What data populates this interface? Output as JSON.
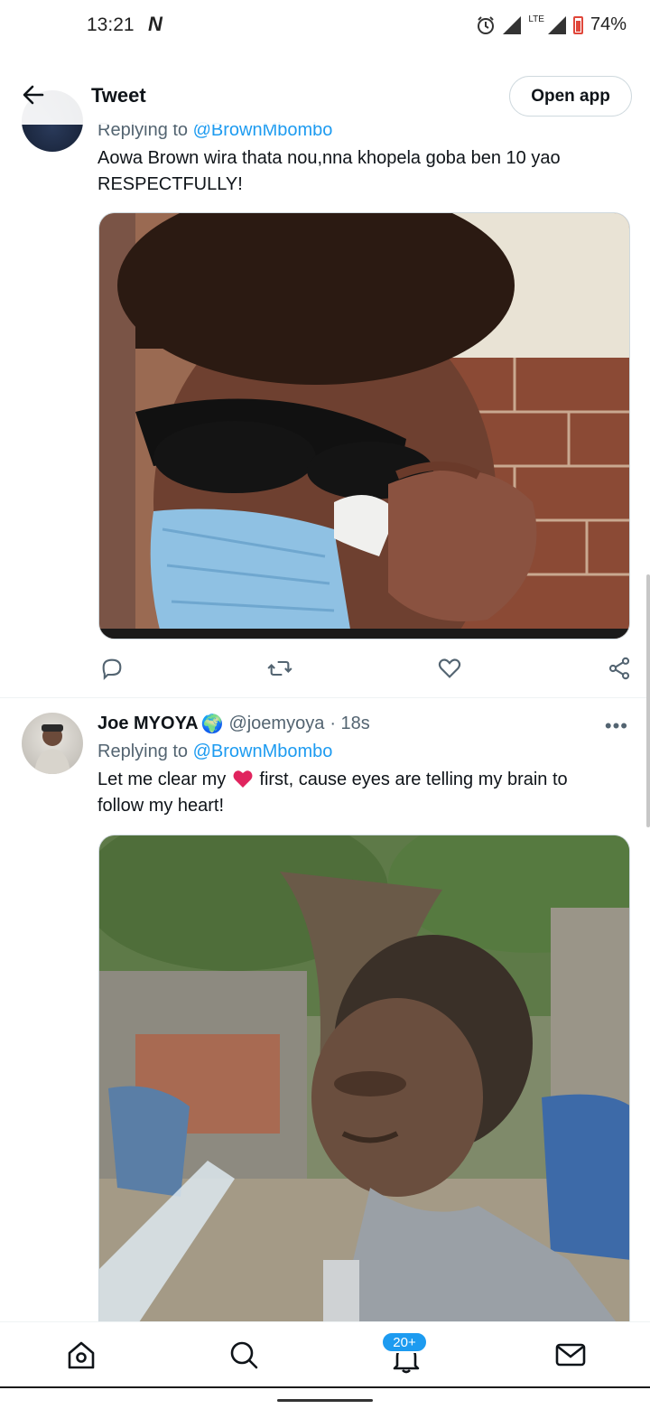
{
  "status_bar": {
    "time": "13:21",
    "carrier_icon": "N",
    "network": "LTE",
    "battery": "74%"
  },
  "header": {
    "back_icon": "arrow-left-icon",
    "title": "Tweet",
    "open_app_label": "Open app"
  },
  "tweets": [
    {
      "reply_prefix": "Replying to",
      "reply_to": "@BrownMbombo",
      "text_line1": "Aowa Brown wira thata nou,nna khopela goba ben 10 yao",
      "text_line2": "RESPECTFULLY!"
    },
    {
      "name": "Joe MYOYA",
      "name_emoji": "🌍",
      "handle": "@joemyoya",
      "time": "· 18s",
      "more": "•••",
      "reply_prefix": "Replying to",
      "reply_to": "@BrownMbombo",
      "text_part1": "Let me clear my",
      "text_part2": "first, cause eyes are telling my brain to",
      "text_line2": "follow my heart!"
    }
  ],
  "bottom_nav": {
    "items": [
      "home-icon",
      "search-icon",
      "notifications-icon",
      "messages-icon"
    ],
    "notifications_badge": "20+"
  },
  "colors": {
    "accent": "#1d9bf0",
    "text": "#0f1419",
    "secondary": "#536471",
    "heart": "#e0245e"
  }
}
